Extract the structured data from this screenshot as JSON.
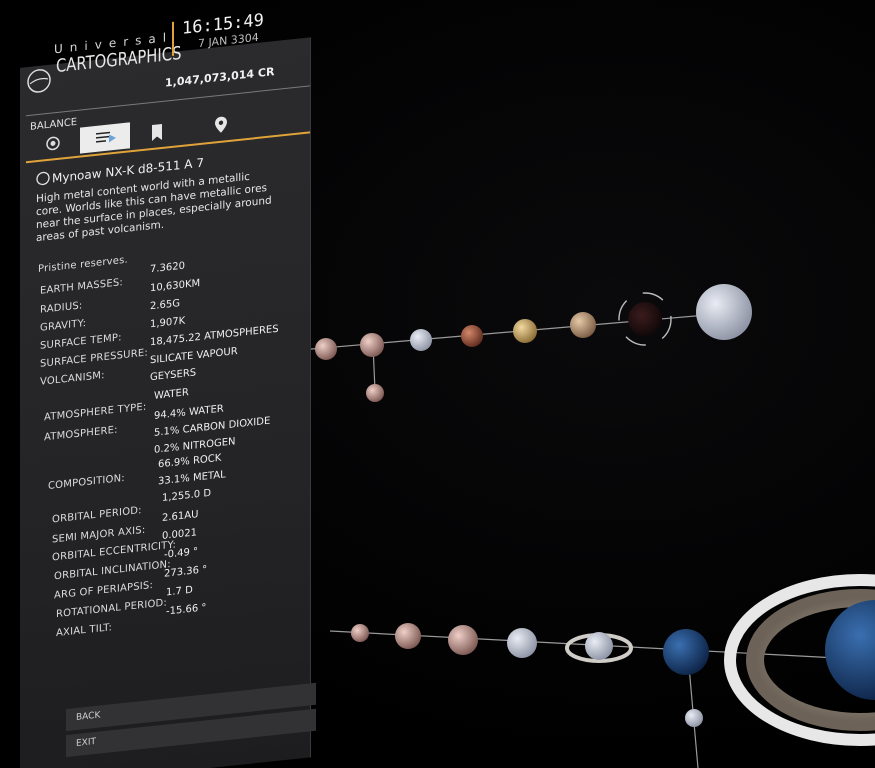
{
  "header": {
    "title_top": "Universal",
    "title": "CARTOGRAPHICS",
    "time": "16:15:49",
    "date": "7 JAN 3304",
    "credits": "1,047,073,014 CR",
    "balance_label": "BALANCE"
  },
  "tabs": [
    {
      "icon": "target-icon",
      "active": false
    },
    {
      "icon": "list-play-icon",
      "active": true
    },
    {
      "icon": "bookmark-icon",
      "active": false
    },
    {
      "icon": "map-pin-icon",
      "active": false
    }
  ],
  "body": {
    "name": "Mynoaw NX-K d8-511 A 7",
    "description": "High metal content world with a metallic core. Worlds like this can have metallic ores near the surface in places, especially around areas of past volcanism.",
    "reserves": "Pristine reserves."
  },
  "properties": [
    {
      "label": "EARTH MASSES:",
      "values": [
        "7.3620"
      ]
    },
    {
      "label": "RADIUS:",
      "values": [
        "10,630KM"
      ]
    },
    {
      "label": "GRAVITY:",
      "values": [
        "2.65G"
      ]
    },
    {
      "label": "SURFACE TEMP:",
      "values": [
        "1,907K"
      ]
    },
    {
      "label": "SURFACE PRESSURE:",
      "values": [
        "18,475.22 ATMOSPHERES"
      ]
    },
    {
      "label": "VOLCANISM:",
      "values": [
        "SILICATE VAPOUR",
        "GEYSERS"
      ]
    },
    {
      "label": "ATMOSPHERE TYPE:",
      "values": [
        "WATER"
      ]
    },
    {
      "label": "ATMOSPHERE:",
      "values": [
        "94.4% WATER",
        "5.1% CARBON DIOXIDE",
        "0.2% NITROGEN"
      ]
    },
    {
      "label": "COMPOSITION:",
      "values": [
        "66.9% ROCK",
        "33.1% METAL"
      ]
    },
    {
      "label": "ORBITAL PERIOD:",
      "values": [
        "1,255.0 D"
      ]
    },
    {
      "label": "SEMI MAJOR AXIS:",
      "values": [
        "2.61AU"
      ]
    },
    {
      "label": "ORBITAL ECCENTRICITY:",
      "values": [
        "0.0021"
      ]
    },
    {
      "label": "ORBITAL INCLINATION:",
      "values": [
        "-0.49 °"
      ]
    },
    {
      "label": "ARG OF PERIAPSIS:",
      "values": [
        "273.36 °"
      ]
    },
    {
      "label": "ROTATIONAL PERIOD:",
      "values": [
        "1.7 D"
      ]
    },
    {
      "label": "AXIAL TILT:",
      "values": [
        "-15.66 °"
      ]
    }
  ],
  "footer": {
    "back": "BACK",
    "exit": "EXIT"
  },
  "colors": {
    "accent": "#e0a33a",
    "panel": "#2b2b2d"
  }
}
